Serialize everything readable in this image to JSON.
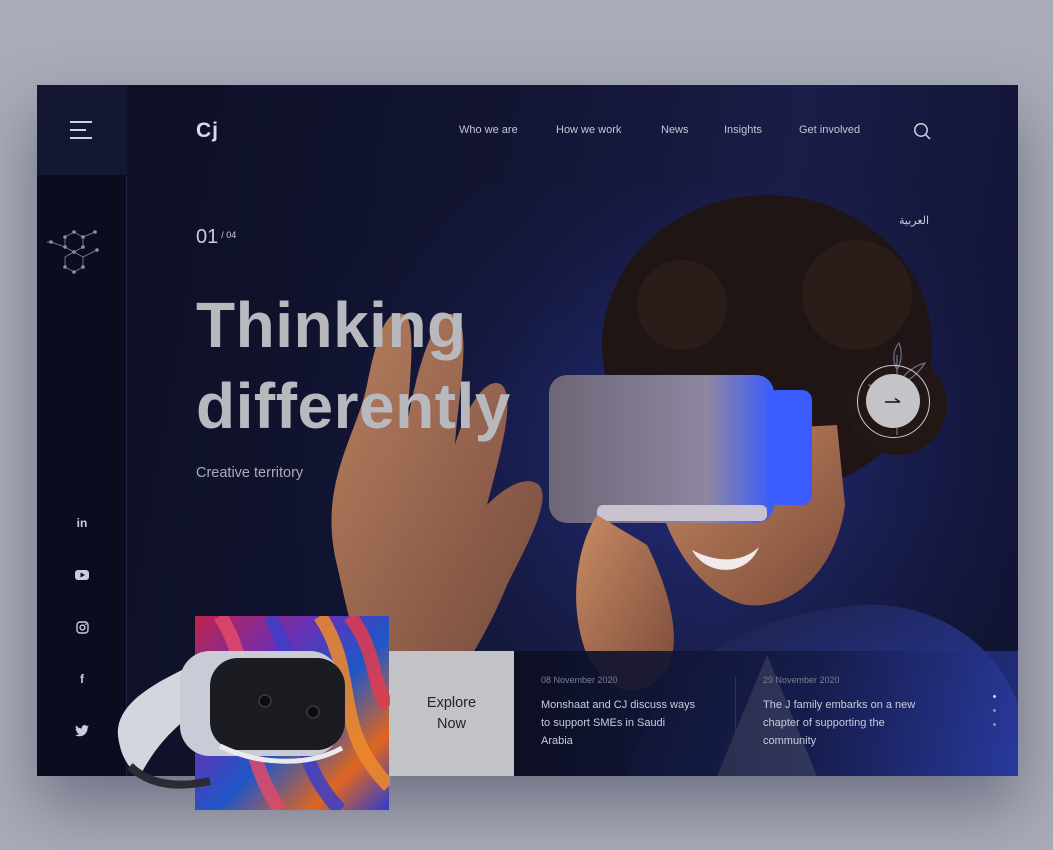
{
  "brand": {
    "logo": "Cj"
  },
  "nav": {
    "items": [
      "Who we are",
      "How we work",
      "News",
      "Insights",
      "Get involved"
    ]
  },
  "language_switch": "العربية",
  "slider": {
    "current": "01",
    "total": "/ 04",
    "active_dot": 0,
    "dots": 3
  },
  "hero": {
    "line1": "Thinking",
    "line2": "differently",
    "tagline": "Creative territory"
  },
  "cta": {
    "explore_line1": "Explore",
    "explore_line2": "Now"
  },
  "news": [
    {
      "date": "08 November 2020",
      "line1": "Monshaat and CJ discuss ways",
      "line2": "to support SMEs in Saudi",
      "line3": "Arabia"
    },
    {
      "date": "29 November 2020",
      "line1": "The J family embarks on a new",
      "line2": "chapter of supporting the",
      "line3": "community"
    }
  ],
  "social": [
    "linkedin-icon",
    "youtube-icon",
    "instagram-icon",
    "facebook-icon",
    "twitter-icon"
  ],
  "colors": {
    "background": "#a9acb7",
    "panel": "#121533",
    "sidebar": "#0b0d1e",
    "accent_blue": "#3b5bff",
    "explore_bg": "#c2c3c6"
  }
}
